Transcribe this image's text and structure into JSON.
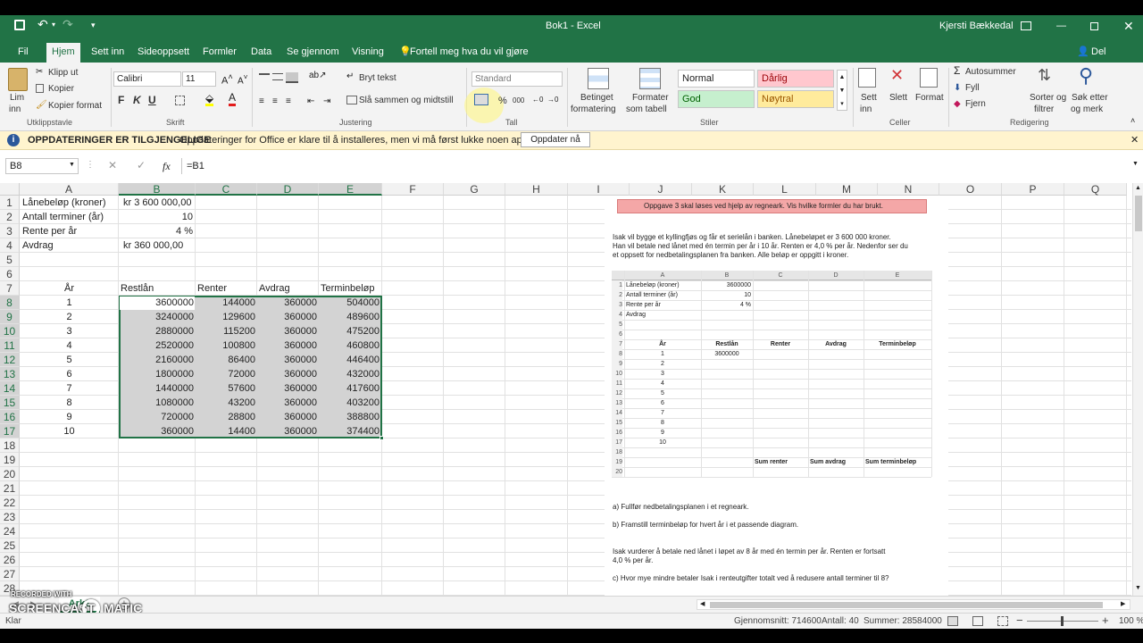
{
  "app": {
    "window_title": "Bok1 - Excel",
    "user": "Kjersti Bækkedal",
    "share": "Del"
  },
  "ribbon_tabs": [
    "Fil",
    "Hjem",
    "Sett inn",
    "Sideoppsett",
    "Formler",
    "Data",
    "Se gjennom",
    "Visning"
  ],
  "tell_me": "Fortell meg hva du vil gjøre",
  "ribbon": {
    "clipboard": {
      "paste": "Lim",
      "paste2": "inn",
      "cut": "Klipp ut",
      "copy": "Kopier",
      "format_painter": "Kopier format",
      "label": "Utklippstavle"
    },
    "font": {
      "name": "Calibri",
      "size": "11",
      "bold": "F",
      "italic": "K",
      "underline": "U",
      "label": "Skrift"
    },
    "alignment": {
      "wrap": "Bryt tekst",
      "merge": "Slå sammen og midtstill",
      "label": "Justering"
    },
    "number": {
      "format": "Standard",
      "percent": "%",
      "thousands": "000",
      "label": "Tall"
    },
    "styles": {
      "cond": "Betinget",
      "cond2": "formatering",
      "table": "Formater",
      "table2": "som tabell",
      "normal": "Normal",
      "bad": "Dårlig",
      "good": "God",
      "neutral": "Nøytral",
      "label": "Stiler"
    },
    "cells": {
      "insert": "Sett",
      "insert2": "inn",
      "delete": "Slett",
      "format": "Format",
      "label": "Celler"
    },
    "editing": {
      "autosum": "Autosummer",
      "fill": "Fyll",
      "clear": "Fjern",
      "sort": "Sorter og",
      "sort2": "filtrer",
      "find": "Søk etter",
      "find2": "og merk",
      "label": "Redigering"
    }
  },
  "infobar": {
    "title": "OPPDATERINGER ER TILGJENGELIGE",
    "message": "Oppdateringer for Office er klare til å installeres, men vi må først lukke noen apper.",
    "button": "Oppdater nå"
  },
  "formula_bar": {
    "name_box": "B8",
    "fx": "fx",
    "formula": "=B1"
  },
  "columns": [
    "A",
    "B",
    "C",
    "D",
    "E",
    "F",
    "G",
    "H",
    "I",
    "J",
    "K",
    "L",
    "M",
    "N",
    "O",
    "P",
    "Q"
  ],
  "sheet": {
    "params": [
      {
        "label": "Lånebeløp (kroner)",
        "value": "kr 3 600 000,00"
      },
      {
        "label": "Antall terminer (år)",
        "value": "10"
      },
      {
        "label": "Rente per år",
        "value": "4 %"
      },
      {
        "label": "Avdrag",
        "value": "kr    360 000,00"
      }
    ],
    "headers": [
      "År",
      "Restlån",
      "Renter",
      "Avdrag",
      "Terminbeløp"
    ],
    "rows": [
      [
        "1",
        "3600000",
        "144000",
        "360000",
        "504000"
      ],
      [
        "2",
        "3240000",
        "129600",
        "360000",
        "489600"
      ],
      [
        "3",
        "2880000",
        "115200",
        "360000",
        "475200"
      ],
      [
        "4",
        "2520000",
        "100800",
        "360000",
        "460800"
      ],
      [
        "5",
        "2160000",
        "86400",
        "360000",
        "446400"
      ],
      [
        "6",
        "1800000",
        "72000",
        "360000",
        "432000"
      ],
      [
        "7",
        "1440000",
        "57600",
        "360000",
        "417600"
      ],
      [
        "8",
        "1080000",
        "43200",
        "360000",
        "403200"
      ],
      [
        "9",
        "720000",
        "28800",
        "360000",
        "388800"
      ],
      [
        "10",
        "360000",
        "14400",
        "360000",
        "374400"
      ]
    ]
  },
  "doc": {
    "banner": "Oppgave 3 skal løses ved hjelp av regneark. Vis hvilke formler du har brukt.",
    "intro1": "Isak vil bygge et kyllingfjøs og får et serielån i banken. Lånebeløpet er 3 600 000 kroner.",
    "intro2": "Han vil betale ned lånet med én termin per år i 10 år. Renten er 4,0 % per år. Nedenfor ser du",
    "intro3": "et oppsett for nedbetalingsplanen fra banken. Alle beløp er oppgitt i kroner.",
    "mini_cols": [
      "A",
      "B",
      "C",
      "D",
      "E"
    ],
    "mini_rows": [
      [
        "1",
        "Lånebeløp (kroner)",
        "3600000"
      ],
      [
        "2",
        "Antall terminer (år)",
        "10"
      ],
      [
        "3",
        "Rente per år",
        "4 %"
      ],
      [
        "4",
        "Avdrag",
        ""
      ],
      [
        "5",
        "",
        ""
      ],
      [
        "6",
        "",
        ""
      ]
    ],
    "mini_headers": [
      "År",
      "Restlån",
      "Renter",
      "Avdrag",
      "Terminbeløp"
    ],
    "mini_b8": "3600000",
    "mini_years": [
      "1",
      "2",
      "3",
      "4",
      "5",
      "6",
      "7",
      "8",
      "9",
      "10"
    ],
    "mini_sums": [
      "Sum renter",
      "Sum avdrag",
      "Sum terminbeløp"
    ],
    "qa": "a)    Fullfør nedbetalingsplanen i et regneark.",
    "qb": "b)    Framstill terminbeløp for hvert år i et passende diagram.",
    "text2a": "Isak vurderer å betale ned lånet i løpet av 8 år med én termin per år. Renten er fortsatt",
    "text2b": "4,0 % per år.",
    "qc": "c)    Hvor mye mindre betaler Isak i renteutgifter totalt ved å redusere antall terminer til 8?"
  },
  "sheet_tab": "Ark1",
  "watermark": {
    "line1": "RECORDED WITH",
    "line2": "SCREENCAST",
    "line3": "MATIC"
  },
  "status": {
    "mode": "Klar",
    "average": "Gjennomsnitt: 714600",
    "count": "Antall: 40",
    "sum": "Summer: 28584000",
    "zoom": "100 %"
  },
  "colors": {
    "excel_green": "#217346",
    "selection": "#d3d3d3"
  }
}
